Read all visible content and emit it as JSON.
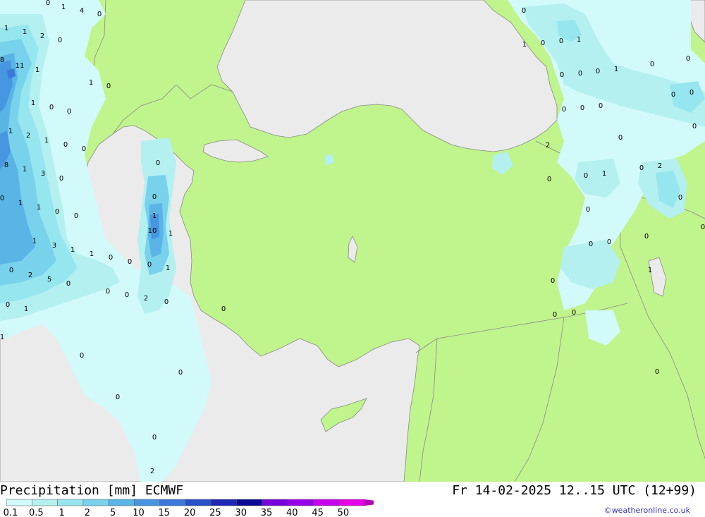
{
  "footer": {
    "title": "Precipitation [mm] ECMWF",
    "valid_time": "Fr 14-02-2025 12..15 UTC (12+99)",
    "credit": "©weatheronline.co.uk"
  },
  "legend": {
    "ticks": [
      "0.1",
      "0.5",
      "1",
      "2",
      "5",
      "10",
      "15",
      "20",
      "25",
      "30",
      "35",
      "40",
      "45",
      "50"
    ],
    "colors": [
      "#d2fafa",
      "#b4f0f0",
      "#96e6f0",
      "#78d2eb",
      "#5ab4e6",
      "#4696e1",
      "#3c78dc",
      "#2850c8",
      "#1e28b4",
      "#0a0a96",
      "#7800dc",
      "#9600e6",
      "#c800f0",
      "#e600e6",
      "#b400b4"
    ]
  },
  "map": {
    "land_color": "#c0f48c",
    "sea_color": "#ebebeb",
    "precip_values": [
      "0",
      "1",
      "4",
      "0",
      "1",
      "1",
      "2",
      "0",
      "8",
      "11",
      "1",
      "1",
      "0",
      "1",
      "0",
      "0",
      "1",
      "2",
      "1",
      "0",
      "0",
      "8",
      "1",
      "3",
      "0",
      "0",
      "0",
      "1",
      "1",
      "0",
      "0",
      "3",
      "1",
      "1",
      "0",
      "2",
      "5",
      "0",
      "0",
      "1",
      "1",
      "0",
      "1",
      "1",
      "10",
      "1",
      "0",
      "1",
      "0",
      "0",
      "0",
      "2",
      "0",
      "0",
      "0",
      "0",
      "0",
      "0",
      "0",
      "2",
      "0",
      "1",
      "0",
      "0",
      "1",
      "0",
      "0",
      "0",
      "1",
      "0",
      "0",
      "0",
      "0",
      "0",
      "0",
      "0",
      "2",
      "0",
      "0",
      "0",
      "0",
      "1",
      "0",
      "2",
      "0",
      "0",
      "0",
      "0",
      "0",
      "0",
      "1",
      "0",
      "0",
      "0",
      "0"
    ]
  }
}
